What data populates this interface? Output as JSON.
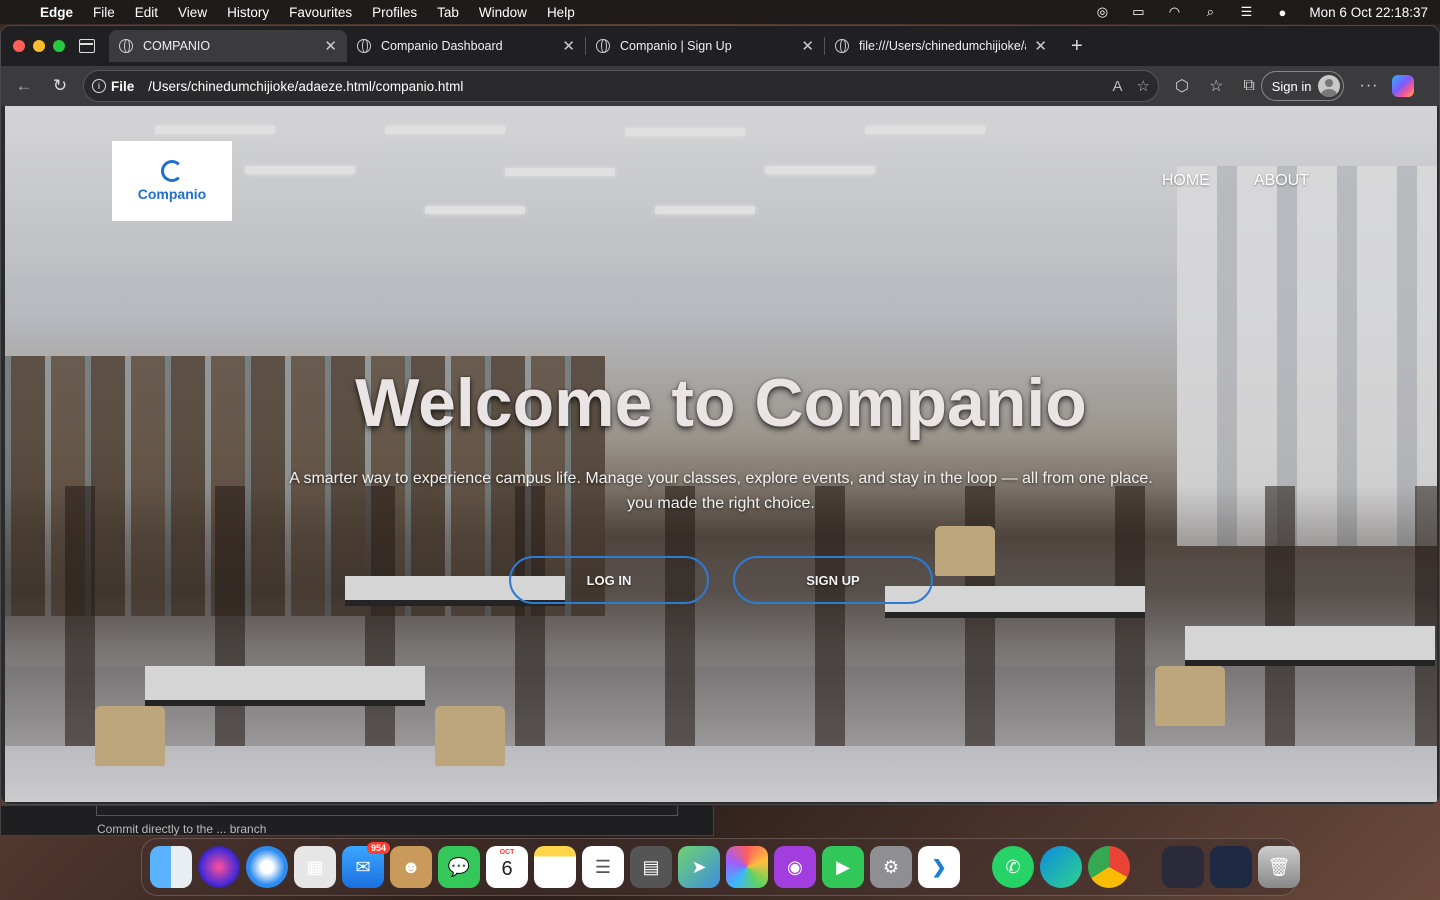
{
  "menubar": {
    "app_name": "Edge",
    "items": [
      "File",
      "Edit",
      "View",
      "History",
      "Favourites",
      "Profiles",
      "Tab",
      "Window",
      "Help"
    ],
    "clock": "Mon 6 Oct  22:18:37"
  },
  "browser": {
    "tabs": [
      {
        "title": "COMPANIO",
        "active": true
      },
      {
        "title": "Companio Dashboard",
        "active": false
      },
      {
        "title": "Companio | Sign Up",
        "active": false
      },
      {
        "title": "file:///Users/chinedumchijioke/a",
        "active": false
      }
    ],
    "address": {
      "scheme_label": "File",
      "url": "/Users/chinedumchijioke/adaeze.html/companio.html"
    },
    "signin_label": "Sign in"
  },
  "page": {
    "logo_text": "Companio",
    "nav": [
      "HOME",
      "ABOUT"
    ],
    "hero_title": "Welcome to Companio",
    "hero_subtitle_line1": "A smarter way to experience campus life. Manage your classes, explore events, and stay in the loop — all from one place.",
    "hero_subtitle_line2": "you made the right choice.",
    "login_label": "LOG IN",
    "signup_label": "SIGN UP",
    "accent_color": "#2d7bd2"
  },
  "background_window": {
    "visible_text": "Commit directly to the ... branch"
  },
  "dock": {
    "mail_badge": "954",
    "calendar_month": "OCT",
    "calendar_day": "6"
  }
}
